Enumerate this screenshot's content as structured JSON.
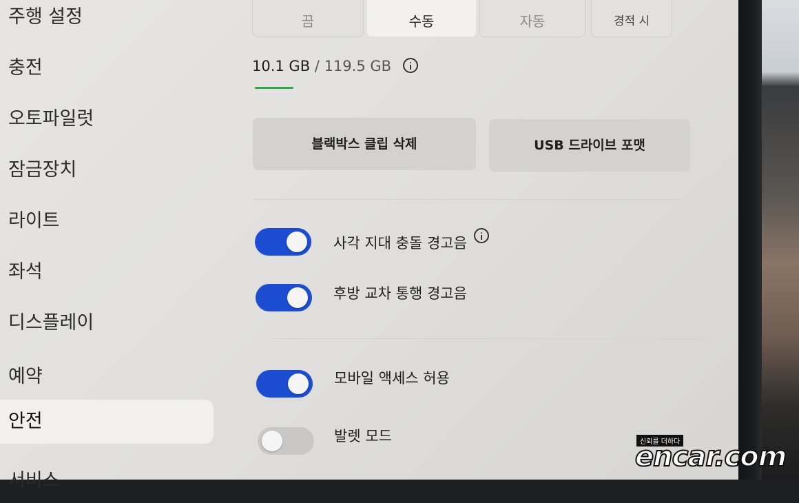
{
  "sidebar": {
    "items": [
      {
        "label": "주행 설정"
      },
      {
        "label": "충전"
      },
      {
        "label": "오토파일럿"
      },
      {
        "label": "잠금장치"
      },
      {
        "label": "라이트"
      },
      {
        "label": "좌석"
      },
      {
        "label": "디스플레이"
      },
      {
        "label": "예약"
      },
      {
        "label": "안전",
        "active": true
      },
      {
        "label": "서비스"
      }
    ]
  },
  "mode_selector": {
    "options": [
      "끔",
      "수동",
      "자동",
      "경적 시"
    ],
    "selected": "수동"
  },
  "storage": {
    "used": "10.1 GB",
    "separator": " / ",
    "total": "119.5 GB",
    "used_fraction": 0.085
  },
  "buttons": {
    "delete_clips": "블랙박스 클립 삭제",
    "format_usb": "USB 드라이브 포맷"
  },
  "toggles": [
    {
      "label": "사각 지대 충돌 경고음",
      "on": true,
      "has_info": true
    },
    {
      "label": "후방 교차 통행 경고음",
      "on": true,
      "has_info": false
    },
    {
      "label": "모바일 액세스 허용",
      "on": true,
      "has_info": false
    },
    {
      "label": "발렛 모드",
      "on": false,
      "has_info": false
    }
  ],
  "watermark": {
    "tagline": "신뢰를 더하다",
    "logo": "encar.com"
  },
  "colors": {
    "toggle_on": "#1c4cd0",
    "toggle_off": "#c9c8c6",
    "usage_bar": "#2fa844",
    "background": "#e3e2e0"
  }
}
